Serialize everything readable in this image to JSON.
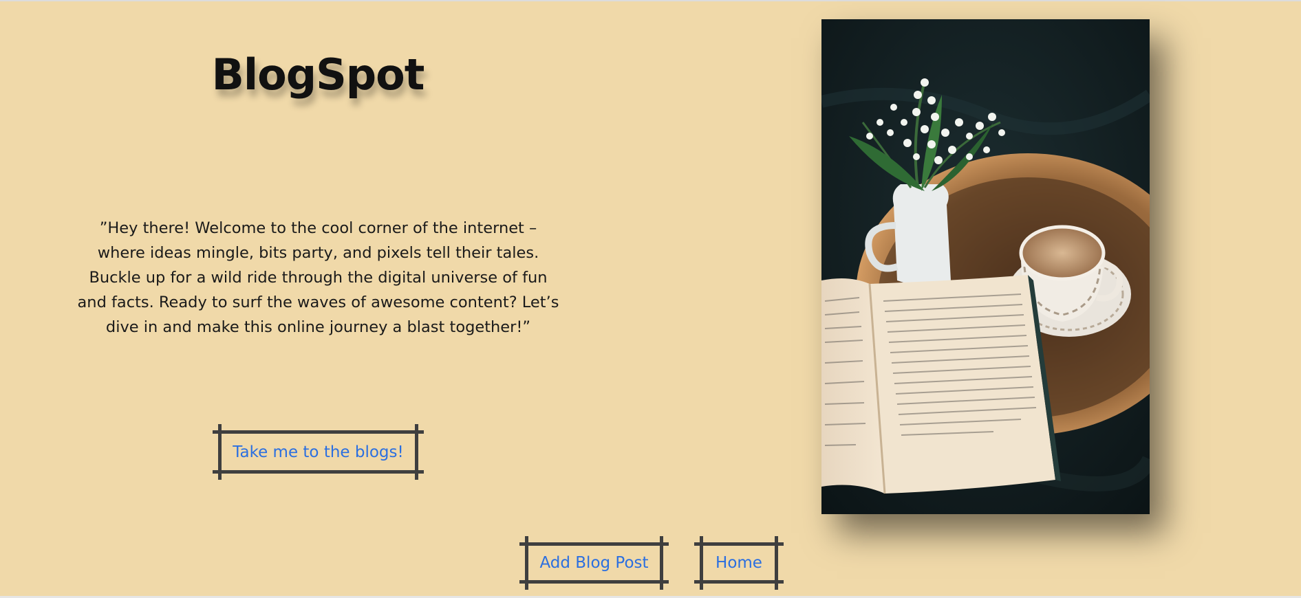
{
  "header": {
    "title": "BlogSpot"
  },
  "hero": {
    "text": "”Hey there! Welcome to the cool corner of the internet – where ideas mingle, bits party, and pixels tell their tales. Buckle up for a wild ride through the digital universe of fun and facts. Ready to surf the waves of awesome content? Let’s dive in and make this online journey a blast together!”",
    "cta_label": "Take me to the blogs!"
  },
  "nav": {
    "add_post_label": "Add Blog Post",
    "home_label": "Home"
  },
  "theme": {
    "background": "#f0d9a9",
    "link": "#2b6fe0",
    "frame": "#3f3f3f"
  },
  "image": {
    "subject": "open book, coffee cup and lily-of-the-valley vase on a wooden tray"
  }
}
